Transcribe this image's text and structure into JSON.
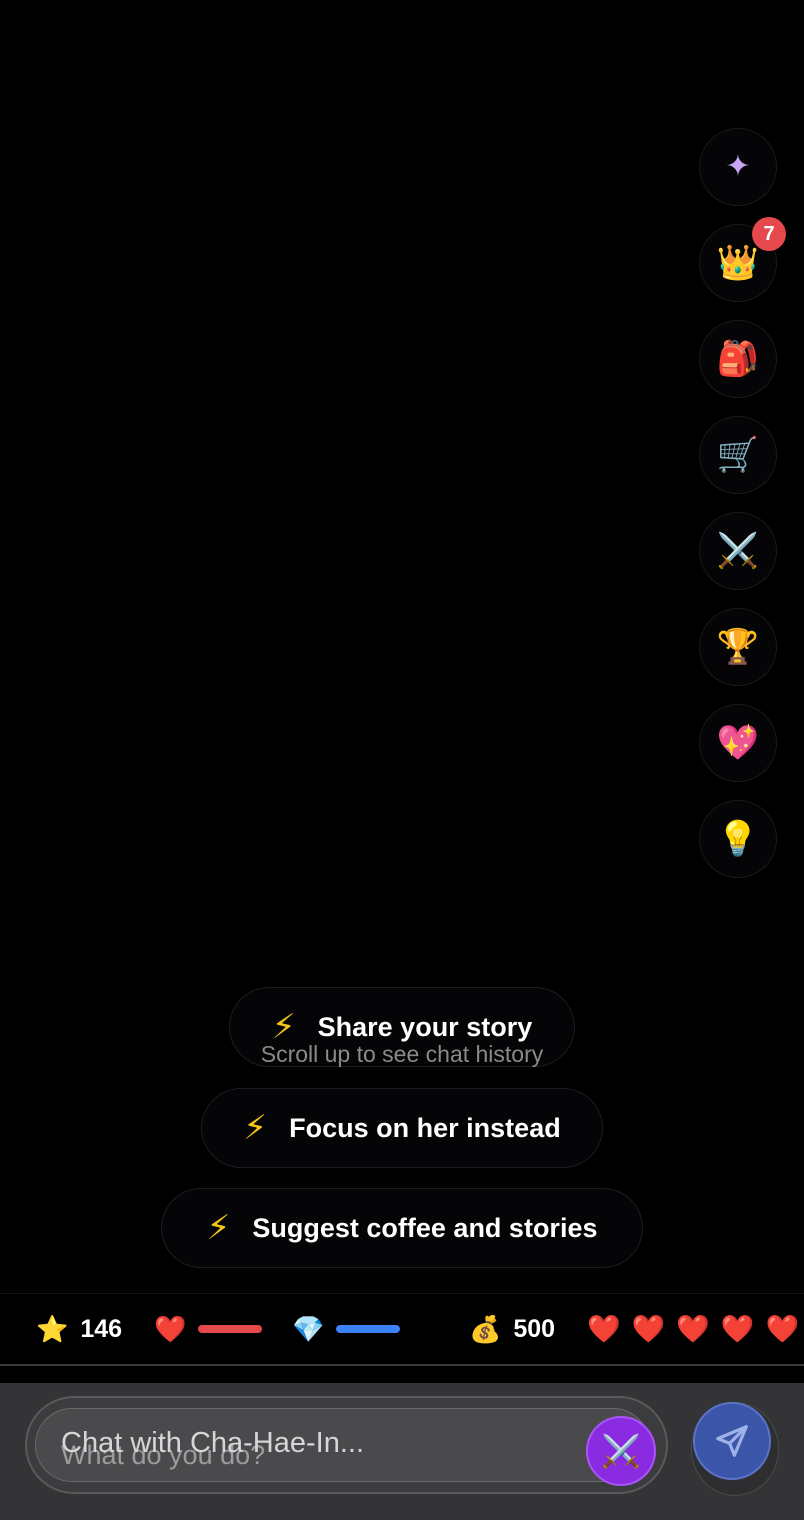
{
  "rail": {
    "items": [
      {
        "name": "sparkle",
        "icon": "✦"
      },
      {
        "name": "crown",
        "icon": "👑",
        "badge": "7"
      },
      {
        "name": "backpack",
        "icon": "🎒"
      },
      {
        "name": "cart",
        "icon": "🛒"
      },
      {
        "name": "swords",
        "icon": "⚔️"
      },
      {
        "name": "trophy",
        "icon": "🏆"
      },
      {
        "name": "sparkling-heart",
        "icon": "💖"
      },
      {
        "name": "lightbulb",
        "icon": "💡"
      }
    ]
  },
  "actions": {
    "bolt": "⚡",
    "items": [
      {
        "label": "Share your story"
      },
      {
        "label": "Focus on her instead"
      },
      {
        "label": "Suggest coffee and stories"
      }
    ],
    "scroll_hint": "Scroll up to see chat history"
  },
  "stats": {
    "star_icon": "⭐",
    "level": "146",
    "heart_icon": "❤️",
    "health_fill": 1.0,
    "health_color": "#e5484d",
    "mana_icon": "💎",
    "mana_fill": 1.0,
    "mana_color": "#3b82f6",
    "gold_icon": "💰",
    "gold": "500",
    "hearts": [
      "❤️",
      "❤️",
      "❤️",
      "❤️",
      "❤️"
    ]
  },
  "composer": {
    "placeholder": "What do you do?",
    "overlay_text": "Chat with Cha-Hae-In...",
    "mode_icon": "⚔️",
    "send_icon": "paper-plane-icon"
  }
}
